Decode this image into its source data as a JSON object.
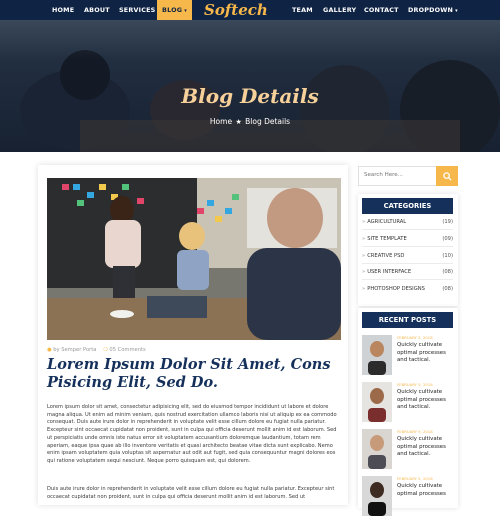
{
  "nav": {
    "items": [
      "HOME",
      "ABOUT",
      "SERVICES",
      "BLOG",
      "TEAM",
      "GALLERY",
      "CONTACT",
      "DROPDOWN"
    ],
    "logo": "Softech",
    "active": "BLOG",
    "accent": "#f7b84b",
    "background": "#0f2344"
  },
  "hero": {
    "title": "Blog Details",
    "breadcrumb_home": "Home",
    "breadcrumb_current": "Blog Details"
  },
  "post": {
    "author": "by Semper Porta",
    "comments": "05 Comments",
    "title": "Lorem Ipsum Dolor Sit Amet, Cons Pisicing Elit, Sed Do.",
    "paragraph1": "Lorem ipsum dolor sit amet, consectetur adipisicing elit, sed do eiusmod tempor incididunt ut labore et dolore magna aliqua. Ut enim ad minim veniam, quis nostrud exercitation ullamco laboris nisi ut aliquip ex ea commodo consequat. Duis aute irure dolor in reprehenderit in voluptate velit esse cillum dolore eu fugiat nulla pariatur. Excepteur sint occaecat cupidatat non proident, sunt in culpa qui officia deserunt mollit anim id est laborum. Sed ut perspiciatis unde omnis iste natus error sit voluptatem accusantium doloremque laudantium, totam rem aperiam, eaque ipsa quae ab illo inventore veritatis et quasi architecto beatae vitae dicta sunt explicabo. Nemo enim ipsam voluptatem quia voluptas sit aspernatur aut odit aut fugit, sed quia consequuntur magni dolores eos qui ratione voluptatem sequi nesciunt. Neque porro quisquam est, qui dolorem.",
    "paragraph2": "Duis aute irure dolor in reprehenderit in voluptate velit esse cillum dolore eu fugiat nulla pariatur. Excepteur sint occaecat cupidatat non proident, sunt in culpa qui officia deserunt mollit anim id est laborum. Sed ut"
  },
  "sidebar": {
    "search_placeholder": "Search Here...",
    "categories_title": "CATEGORIES",
    "categories": [
      {
        "label": "AGRICULTURAL",
        "count": "(19)"
      },
      {
        "label": "SITE TEMPLATE",
        "count": "(09)"
      },
      {
        "label": "CREATIVE PSD",
        "count": "(10)"
      },
      {
        "label": "USER INTERFACE",
        "count": "(08)"
      },
      {
        "label": "PHOTOSHOP DESIGNS",
        "count": "(08)"
      }
    ],
    "recent_title": "RECENT POSTS",
    "recent": [
      {
        "date": "FEBRUARY 5, 2018",
        "text": "Quickly cultivate optimal processes and tactical."
      },
      {
        "date": "FEBRUARY 5, 2018",
        "text": "Quickly cultivate optimal processes and tactical."
      },
      {
        "date": "FEBRUARY 9, 2018",
        "text": "Quickly cultivate optimal processes and tactical."
      },
      {
        "date": "FEBRUARY 5, 2018",
        "text": "Quickly cultivate optimal processes"
      }
    ]
  }
}
